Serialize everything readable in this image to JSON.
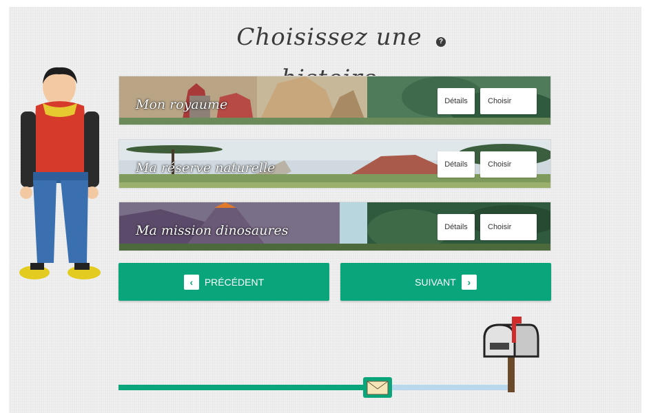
{
  "page": {
    "title": "Choisissez une histoire",
    "help_icon": "?"
  },
  "stories": [
    {
      "title": "Mon royaume",
      "details_label": "Détails",
      "choose_label": "Choisir"
    },
    {
      "title": "Ma réserve naturelle",
      "details_label": "Détails",
      "choose_label": "Choisir"
    },
    {
      "title": "Ma mission dinosaures",
      "details_label": "Détails",
      "choose_label": "Choisir"
    }
  ],
  "navigation": {
    "previous_label": "PRÉCÉDENT",
    "next_label": "SUIVANT",
    "previous_icon": "‹",
    "next_icon": "›"
  },
  "progress": {
    "fraction": 0.63,
    "icons": [
      "envelope-icon",
      "mailbox-icon"
    ]
  },
  "colors": {
    "accent": "#0aa57a",
    "progress_rest": "#b9d8ee",
    "background": "#ececec"
  }
}
